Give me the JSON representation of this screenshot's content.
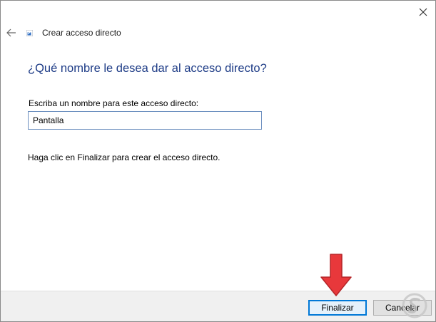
{
  "window": {
    "title": "Crear acceso directo"
  },
  "icons": {
    "close": "close-icon",
    "back": "back-arrow-icon",
    "app": "shortcut-app-icon",
    "pointer": "red-down-arrow-icon",
    "watermark": "solvetic-logo-icon"
  },
  "main": {
    "heading": "¿Qué nombre le desea dar al acceso directo?",
    "field_label": "Escriba un nombre para este acceso directo:",
    "field_value": "Pantalla",
    "instruction": "Haga clic en Finalizar para crear el acceso directo."
  },
  "footer": {
    "finish_label": "Finalizar",
    "cancel_label": "Cancelar"
  },
  "colors": {
    "heading": "#1d3b86",
    "input_border": "#6c8fbf",
    "focus": "#0078d7",
    "pointer_arrow": "#e8383b"
  }
}
